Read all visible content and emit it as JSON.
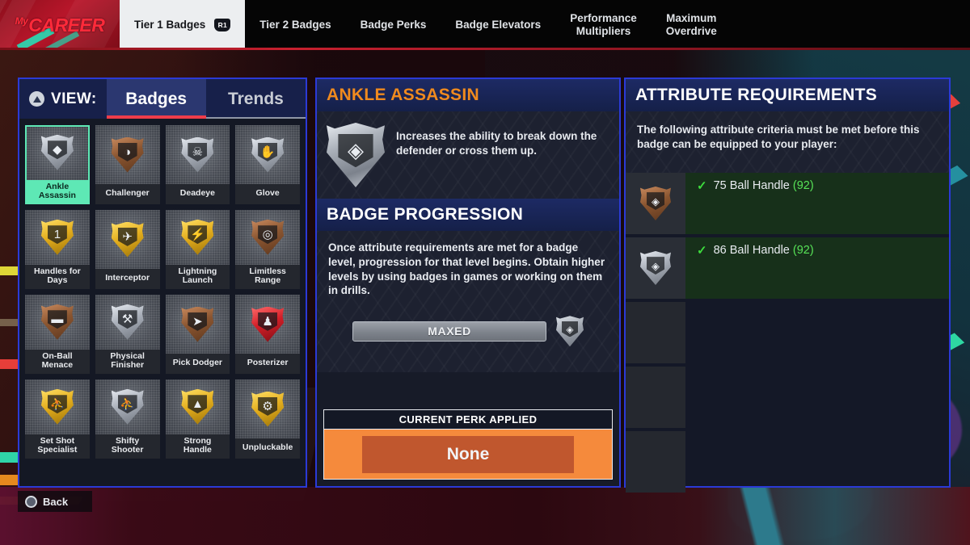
{
  "topbar": {
    "brand_prefix": "My",
    "brand": "CAREER",
    "tabs": [
      {
        "label": "Tier 1 Badges",
        "active": true,
        "chip": "R1"
      },
      {
        "label": "Tier 2 Badges",
        "active": false,
        "chip": ""
      },
      {
        "label": "Badge Perks",
        "active": false,
        "chip": ""
      },
      {
        "label": "Badge Elevators",
        "active": false,
        "chip": ""
      },
      {
        "label": "Performance\nMultipliers",
        "active": false,
        "chip": ""
      },
      {
        "label": "Maximum\nOverdrive",
        "active": false,
        "chip": ""
      }
    ]
  },
  "left_panel": {
    "view_label": "VIEW:",
    "view_icon": "playstation-triangle-icon",
    "tabs": [
      {
        "label": "Badges",
        "selected": true
      },
      {
        "label": "Trends",
        "selected": false
      }
    ],
    "badges": [
      {
        "name": "Ankle\nAssassin",
        "tier": "silver",
        "glyph": "◆",
        "selected": true
      },
      {
        "name": "Challenger",
        "tier": "bronze",
        "glyph": "◑",
        "selected": false
      },
      {
        "name": "Deadeye",
        "tier": "silver",
        "glyph": "☠",
        "selected": false
      },
      {
        "name": "Glove",
        "tier": "silver",
        "glyph": "✋",
        "selected": false
      },
      {
        "name": "Handles for\nDays",
        "tier": "gold",
        "glyph": "1",
        "selected": false
      },
      {
        "name": "Interceptor",
        "tier": "gold",
        "glyph": "✈",
        "selected": false
      },
      {
        "name": "Lightning\nLaunch",
        "tier": "gold",
        "glyph": "⚡",
        "selected": false
      },
      {
        "name": "Limitless\nRange",
        "tier": "bronze",
        "glyph": "◎",
        "selected": false
      },
      {
        "name": "On-Ball\nMenace",
        "tier": "bronze",
        "glyph": "▬",
        "selected": false
      },
      {
        "name": "Physical\nFinisher",
        "tier": "silver",
        "glyph": "⚒",
        "selected": false
      },
      {
        "name": "Pick Dodger",
        "tier": "bronze",
        "glyph": "➤",
        "selected": false
      },
      {
        "name": "Posterizer",
        "tier": "hof",
        "glyph": "♟",
        "selected": false
      },
      {
        "name": "Set Shot\nSpecialist",
        "tier": "gold",
        "glyph": "⛹",
        "selected": false
      },
      {
        "name": "Shifty\nShooter",
        "tier": "silver",
        "glyph": "⛹",
        "selected": false
      },
      {
        "name": "Strong\nHandle",
        "tier": "gold",
        "glyph": "▲",
        "selected": false
      },
      {
        "name": "Unpluckable",
        "tier": "gold",
        "glyph": "⚙",
        "selected": false
      }
    ],
    "back_button": "Back",
    "back_icon": "playstation-circle-icon"
  },
  "center_panel": {
    "badge_title": "ANKLE ASSASSIN",
    "badge_description": "Increases the ability to break down the defender or cross them up.",
    "badge_icon": "ankle-assassin-shield-icon",
    "progression_title": "BADGE PROGRESSION",
    "progression_description": "Once attribute requirements are met for a badge level, progression for that level begins. Obtain higher levels by using badges in games or working on them in drills.",
    "progress_status": "MAXED",
    "progress_icon": "hof-shield-icon",
    "perk_header": "CURRENT PERK APPLIED",
    "perk_value": "None"
  },
  "right_panel": {
    "title": "ATTRIBUTE REQUIREMENTS",
    "intro": "The following attribute criteria must be met before this badge can be equipped to your player:",
    "requirements": [
      {
        "met": true,
        "check": "✓",
        "threshold": "75",
        "attribute": "Ball Handle",
        "current": "(92)",
        "tier": "bronze",
        "empty": false
      },
      {
        "met": true,
        "check": "✓",
        "threshold": "86",
        "attribute": "Ball Handle",
        "current": "(92)",
        "tier": "silver",
        "empty": false
      },
      {
        "met": false,
        "check": "",
        "threshold": "",
        "attribute": "",
        "current": "",
        "tier": "",
        "empty": true
      },
      {
        "met": false,
        "check": "",
        "threshold": "",
        "attribute": "",
        "current": "",
        "tier": "",
        "empty": true
      },
      {
        "met": false,
        "check": "",
        "threshold": "",
        "attribute": "",
        "current": "",
        "tier": "",
        "empty": true
      }
    ]
  },
  "colors": {
    "panel_border": "#2b3ad6",
    "accent_orange": "#f08a1e",
    "selected_green": "#5ee8b5",
    "tab_underline_red": "#ef3d4a",
    "check_green": "#3ddc3d",
    "perk_orange": "#f58a3c",
    "brand_red": "#ff2a3a"
  }
}
